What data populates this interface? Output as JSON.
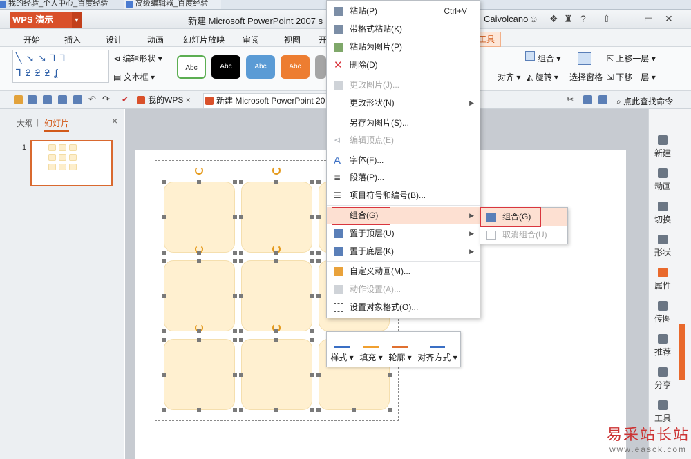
{
  "browser_tabs": [
    "我的经验_个人中心_百度经验",
    "高级编辑器_百度经验"
  ],
  "app": {
    "name": "WPS 演示",
    "doc_title": "新建 Microsoft PowerPoint 2007 s",
    "user": "Caivolcano"
  },
  "ribbon_tabs": [
    "开始",
    "插入",
    "设计",
    "动画",
    "幻灯片放映",
    "审阅",
    "视图",
    "开",
    "工具"
  ],
  "ribbon": {
    "edit_shape": "编辑形状",
    "text_box": "文本框",
    "style_buttons": [
      "Abc",
      "Abc",
      "Abc",
      "Abc",
      "Abc"
    ],
    "style_colors": [
      "#ffffff",
      "#000000",
      "#5b9bd5",
      "#ed7d31",
      "#a5a5a5"
    ],
    "group": "组合",
    "align": "对齐",
    "rotate": "旋转",
    "selection_pane": "选择窗格",
    "bring_forward": "上移一层",
    "send_backward": "下移一层"
  },
  "quick_access": {
    "doc_tabs": [
      "我的WPS",
      "新建 Microsoft PowerPoint 20"
    ],
    "find_command": "点此查找命令"
  },
  "left_panel": {
    "tab_outline": "大纲",
    "tab_slides": "幻灯片",
    "slide_number": "1"
  },
  "context_menu": {
    "items": [
      {
        "label": "粘贴(P)",
        "shortcut": "Ctrl+V",
        "enabled": true,
        "icon": "paste-icon"
      },
      {
        "label": "带格式粘贴(K)",
        "enabled": true,
        "icon": "paste-format-icon"
      },
      {
        "label": "粘贴为图片(P)",
        "enabled": true,
        "icon": "paste-picture-icon"
      },
      {
        "label": "删除(D)",
        "enabled": true,
        "icon": "delete-x-icon"
      },
      {
        "label": "更改图片(J)...",
        "enabled": false,
        "icon": "change-picture-icon"
      },
      {
        "label": "更改形状(N)",
        "enabled": true,
        "submenu": true
      },
      {
        "label": "另存为图片(S)...",
        "enabled": true
      },
      {
        "label": "编辑顶点(E)",
        "enabled": false,
        "icon": "edit-points-icon"
      },
      {
        "label": "字体(F)...",
        "enabled": true,
        "icon": "font-icon"
      },
      {
        "label": "段落(P)...",
        "enabled": true,
        "icon": "paragraph-icon"
      },
      {
        "label": "项目符号和编号(B)...",
        "enabled": true,
        "icon": "bullets-icon"
      },
      {
        "label": "组合(G)",
        "enabled": true,
        "submenu": true,
        "highlighted": true
      },
      {
        "label": "置于顶层(U)",
        "enabled": true,
        "submenu": true,
        "icon": "bring-front-icon"
      },
      {
        "label": "置于底层(K)",
        "enabled": true,
        "submenu": true,
        "icon": "send-back-icon"
      },
      {
        "label": "自定义动画(M)...",
        "enabled": true,
        "icon": "custom-animation-icon"
      },
      {
        "label": "动作设置(A)...",
        "enabled": false,
        "icon": "action-icon"
      },
      {
        "label": "设置对象格式(O)...",
        "enabled": true,
        "icon": "format-object-icon"
      }
    ]
  },
  "sub_menu": {
    "items": [
      {
        "label": "组合(G)",
        "enabled": true,
        "highlighted": true
      },
      {
        "label": "取消组合(U)",
        "enabled": false
      }
    ]
  },
  "mini_toolbar": [
    "样式",
    "填充",
    "轮廓",
    "对齐方式"
  ],
  "right_sidebar": [
    "新建",
    "动画",
    "切换",
    "形状",
    "属性",
    "传图",
    "推荐",
    "分享",
    "工具"
  ],
  "watermark": {
    "cn": "易采站长站",
    "url": "www.easck.com"
  }
}
